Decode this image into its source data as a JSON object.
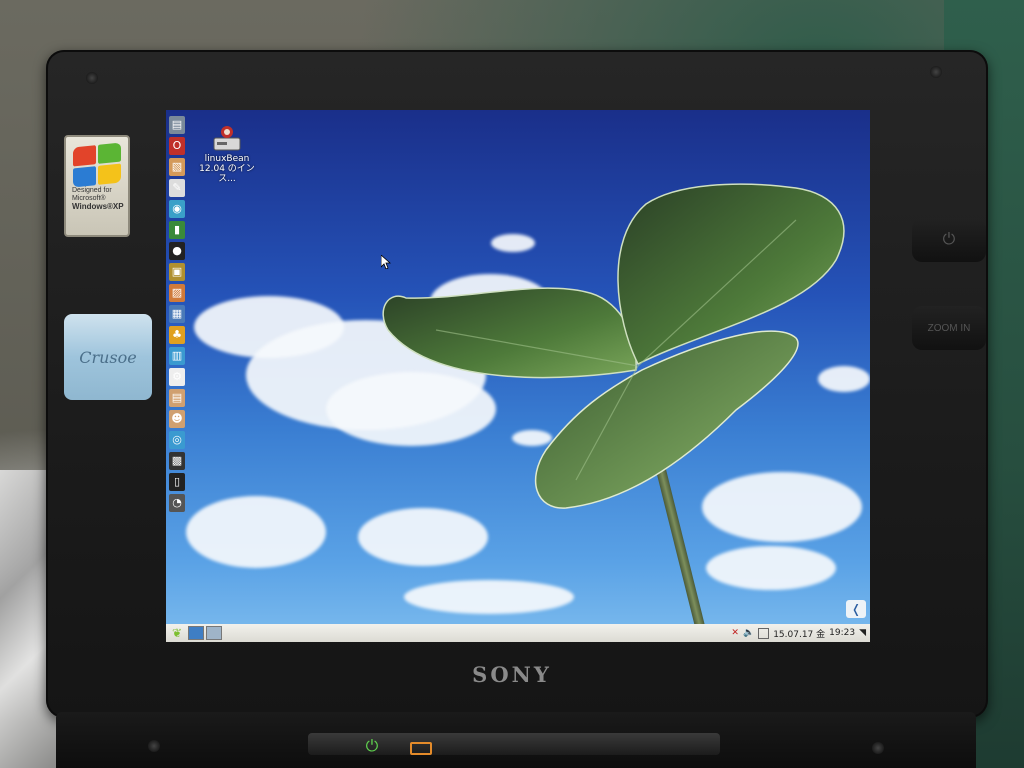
{
  "hardware": {
    "brand_logo": "SONY",
    "sticker_xp_lines": [
      "Designed for",
      "Microsoft®",
      "Windows®XP"
    ],
    "sticker_crusoe": "Crusoe",
    "side_buttons": [
      "⏻",
      "ZOOM IN"
    ]
  },
  "desktop": {
    "icons": [
      {
        "name": "linuxbean-installer",
        "label_line1": "linuxBean",
        "label_line2": "12.04 のインス..."
      }
    ],
    "dock_icons": [
      {
        "id": "file-manager-icon",
        "glyph": "▤",
        "color": "#7a8a9a"
      },
      {
        "id": "opera-icon",
        "glyph": "O",
        "color": "#c0302a"
      },
      {
        "id": "image-viewer-icon",
        "glyph": "▧",
        "color": "#d49a5a"
      },
      {
        "id": "text-editor-icon",
        "glyph": "✎",
        "color": "#dddddd"
      },
      {
        "id": "network-icon",
        "glyph": "◉",
        "color": "#3aa0c8"
      },
      {
        "id": "notes-icon",
        "glyph": "▮",
        "color": "#3a8a3a"
      },
      {
        "id": "disk-icon",
        "glyph": "●",
        "color": "#222222"
      },
      {
        "id": "package-icon",
        "glyph": "▣",
        "color": "#b09030"
      },
      {
        "id": "paint-icon",
        "glyph": "▨",
        "color": "#d07a3a"
      },
      {
        "id": "photo-icon",
        "glyph": "▦",
        "color": "#4a7ab8"
      },
      {
        "id": "software-icon",
        "glyph": "♣",
        "color": "#e0a020"
      },
      {
        "id": "system-monitor-icon",
        "glyph": "▥",
        "color": "#3a9ad0"
      },
      {
        "id": "settings-icon",
        "glyph": "⚙",
        "color": "#eeeeee"
      },
      {
        "id": "archive-icon",
        "glyph": "▤",
        "color": "#d0a070"
      },
      {
        "id": "user-icon",
        "glyph": "☻",
        "color": "#d0a070"
      },
      {
        "id": "wifi-icon",
        "glyph": "◎",
        "color": "#3a9ad0"
      },
      {
        "id": "chart-icon",
        "glyph": "▩",
        "color": "#333333"
      },
      {
        "id": "terminal-icon",
        "glyph": "▯",
        "color": "#222222"
      },
      {
        "id": "trash-icon",
        "glyph": "◔",
        "color": "#555555"
      }
    ]
  },
  "taskbar": {
    "date": "15.07.17 金",
    "time": "19:23"
  },
  "colors": {
    "taskbar_bg": "#e6e5de",
    "sky_top": "#1a2f8a",
    "sky_bottom": "#7dbcee",
    "leaf": "#4f7a3a"
  }
}
